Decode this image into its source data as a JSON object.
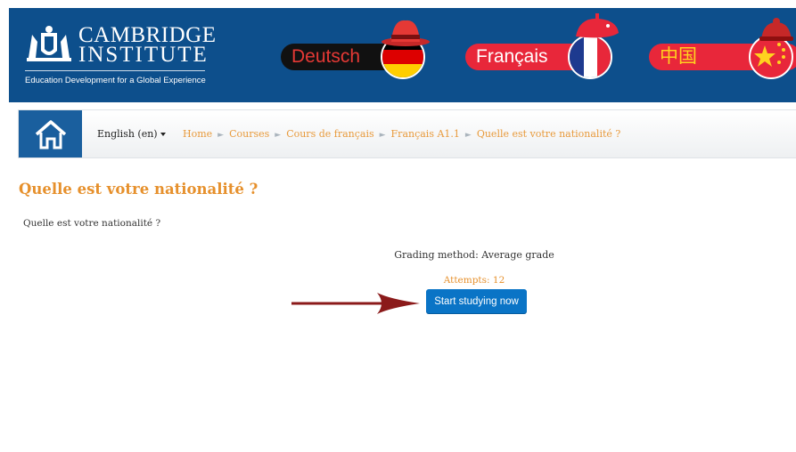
{
  "banner": {
    "logo": {
      "line1": "CAMBRIDGE",
      "line2": "INSTITUTE",
      "tagline": "Education Development for a Global Experience"
    },
    "languages": [
      {
        "label": "Deutsch",
        "pill_color": "#111111",
        "text_color": "#e53935"
      },
      {
        "label": "Français",
        "pill_color": "#e8273a",
        "text_color": "#ffffff"
      },
      {
        "label": "中国",
        "pill_color": "#e8273a",
        "text_color": "#ffd21f"
      }
    ]
  },
  "navbar": {
    "home_icon": "house-icon",
    "language_menu": "English (en)",
    "breadcrumb": [
      "Home",
      "Courses",
      "Cours de français",
      "Français A1.1",
      "Quelle est votre nationalité ?"
    ]
  },
  "content": {
    "title": "Quelle est votre nationalité ?",
    "intro": "Quelle est votre nationalité ?",
    "grading": "Grading method: Average grade",
    "attempts": "Attempts: 12",
    "start_button": "Start studying now"
  },
  "colors": {
    "banner_bg": "#0d4f8c",
    "accent_orange": "#e6902c",
    "button_blue": "#0a74c6",
    "arrow": "#8b1a1a"
  }
}
